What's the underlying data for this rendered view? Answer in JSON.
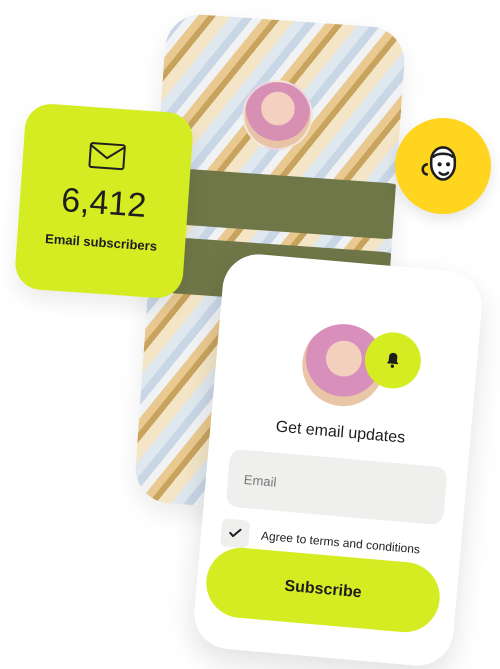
{
  "brand": {
    "name_icon": "mailchimp-icon",
    "color": "#ffd51f"
  },
  "stats": {
    "icon": "mail-icon",
    "count": "6,412",
    "label": "Email subscribers"
  },
  "form": {
    "title": "Get email updates",
    "email_label": "Email",
    "terms_label": "Agree to terms and conditions",
    "subscribe_label": "Subscribe",
    "bell_icon": "bell-icon",
    "check_icon": "check-icon"
  },
  "colors": {
    "accent": "#d5ec23",
    "olive": "#6f7748",
    "field": "#efefee",
    "text": "#1e1e1e"
  }
}
